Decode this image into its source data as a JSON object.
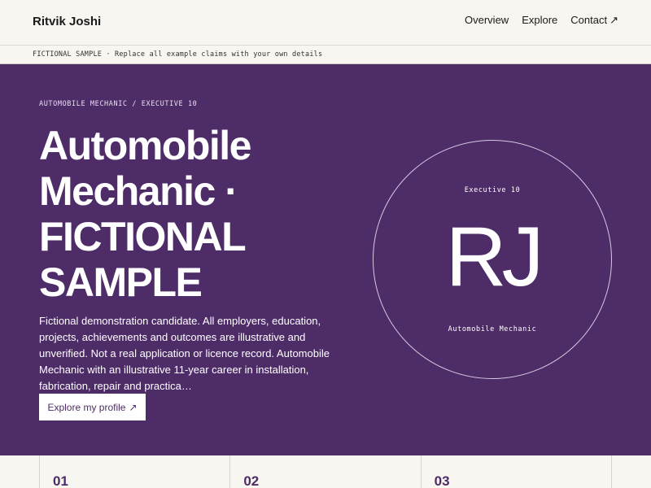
{
  "header": {
    "brand": "Ritvik Joshi",
    "nav": [
      {
        "label": "Overview"
      },
      {
        "label": "Explore"
      },
      {
        "label": "Contact",
        "arrow": "↗"
      }
    ]
  },
  "notice": {
    "text": "FICTIONAL SAMPLE · Replace all example claims with your own details"
  },
  "hero": {
    "eyebrow": "AUTOMOBILE MECHANIC / EXECUTIVE 10",
    "headline": "Automobile Mechanic · FICTIONAL SAMPLE",
    "summary": "Fictional demonstration candidate. All employers, education, projects, achievements and outcomes are illustrative and unverified. Not a real application or licence record. Automobile Mechanic with an illustrative 11-year career in installation, fabrication, repair and practica…",
    "cta_label": "Explore my profile",
    "cta_arrow": "↗",
    "badge": {
      "top": "Executive 10",
      "monogram": "RJ",
      "bottom": "Automobile Mechanic"
    }
  },
  "cards": [
    {
      "number": "01"
    },
    {
      "number": "02"
    },
    {
      "number": "03"
    }
  ],
  "colors": {
    "accent": "#4e2c68",
    "background": "#f8f6f1"
  }
}
